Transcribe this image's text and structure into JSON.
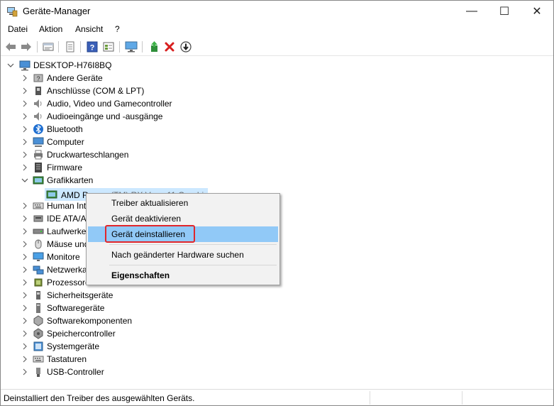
{
  "window": {
    "title": "Geräte-Manager"
  },
  "controls": {
    "minimize": "—",
    "maximize": "☐",
    "close": "✕"
  },
  "menu": [
    "Datei",
    "Aktion",
    "Ansicht",
    "?"
  ],
  "toolbar": {
    "icons": [
      "back-icon",
      "forward-icon",
      "show-hidden-icon",
      "properties-sheet-icon",
      "help-icon",
      "view-icon",
      "monitor-icon",
      "update-driver-icon",
      "uninstall-icon",
      "disable-icon"
    ]
  },
  "tree": {
    "root": "DESKTOP-H76I8BQ",
    "items": [
      {
        "label": "Andere Geräte",
        "icon": "unknown-device-icon"
      },
      {
        "label": "Anschlüsse (COM & LPT)",
        "icon": "port-icon"
      },
      {
        "label": "Audio, Video und Gamecontroller",
        "icon": "speaker-icon"
      },
      {
        "label": "Audioeingänge und -ausgänge",
        "icon": "speaker-icon"
      },
      {
        "label": "Bluetooth",
        "icon": "bluetooth-icon"
      },
      {
        "label": "Computer",
        "icon": "computer-icon"
      },
      {
        "label": "Druckwarteschlangen",
        "icon": "printer-icon"
      },
      {
        "label": "Firmware",
        "icon": "firmware-icon"
      },
      {
        "label": "Grafikkarten",
        "icon": "display-adapter-icon",
        "expanded": true
      },
      {
        "label": "Human Int",
        "icon": "keyboard-icon"
      },
      {
        "label": "IDE ATA/AT",
        "icon": "ide-icon"
      },
      {
        "label": "Laufwerke",
        "icon": "disk-icon"
      },
      {
        "label": "Mäuse und",
        "icon": "mouse-icon"
      },
      {
        "label": "Monitore",
        "icon": "monitor-icon"
      },
      {
        "label": "Netzwerka",
        "icon": "network-icon"
      },
      {
        "label": "Prozessore",
        "icon": "cpu-icon"
      },
      {
        "label": "Sicherheitsgeräte",
        "icon": "security-icon"
      },
      {
        "label": "Softwaregeräte",
        "icon": "software-device-icon"
      },
      {
        "label": "Softwarekomponenten",
        "icon": "software-component-icon"
      },
      {
        "label": "Speichercontroller",
        "icon": "storage-controller-icon"
      },
      {
        "label": "Systemgeräte",
        "icon": "system-device-icon"
      },
      {
        "label": "Tastaturen",
        "icon": "keyboard-icon"
      },
      {
        "label": "USB-Controller",
        "icon": "usb-icon"
      }
    ],
    "child": {
      "label": "AMD Ra",
      "label_tail": "(TM) RX Vega 11 Graphi",
      "icon": "display-adapter-icon"
    }
  },
  "context_menu": {
    "items": [
      "Treiber aktualisieren",
      "Gerät deaktivieren",
      "Gerät deinstallieren",
      "Nach geänderter Hardware suchen",
      "Eigenschaften"
    ],
    "highlighted": "Gerät deinstallieren",
    "highlight_color": "#91c9f7",
    "annotation_color": "#e0262b"
  },
  "status": {
    "text": "Deinstalliert den Treiber des ausgewählten Geräts."
  }
}
